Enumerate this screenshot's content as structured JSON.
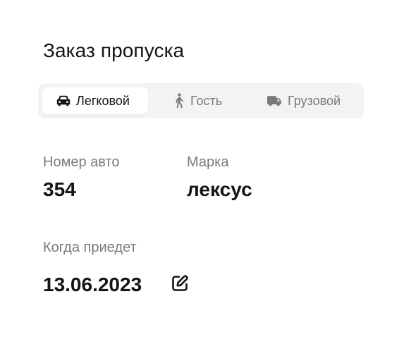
{
  "page": {
    "title": "Заказ пропуска"
  },
  "tabs": [
    {
      "label": "Легковой",
      "icon": "car-icon",
      "active": true
    },
    {
      "label": "Гость",
      "icon": "walking-person-icon",
      "active": false
    },
    {
      "label": "Грузовой",
      "icon": "truck-icon",
      "active": false
    }
  ],
  "fields": {
    "plate_label": "Номер авто",
    "plate_value": "354",
    "brand_label": "Марка",
    "brand_value": "лексус",
    "arrival_label": "Когда приедет",
    "arrival_value": "13.06.2023"
  },
  "colors": {
    "text_primary": "#151515",
    "text_secondary": "#7b7b7b",
    "segment_bg": "#f3f3f4",
    "segment_active_bg": "#ffffff"
  }
}
